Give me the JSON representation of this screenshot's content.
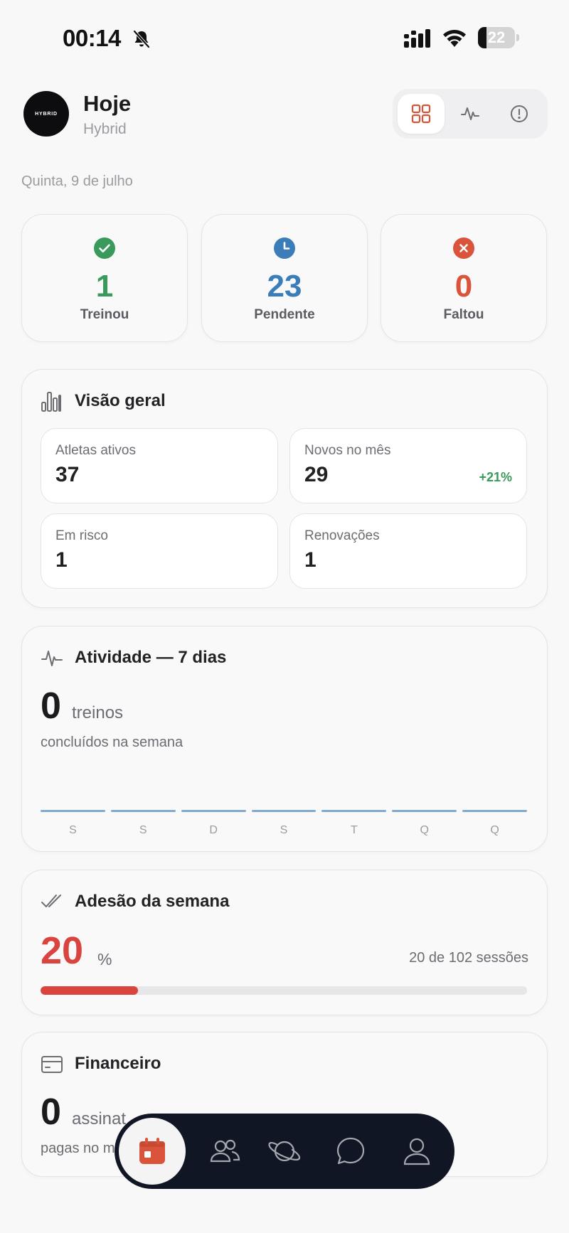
{
  "status_bar": {
    "time": "00:14",
    "battery": "22"
  },
  "header": {
    "logo_text": "HYBRID",
    "title": "Hoje",
    "subtitle": "Hybrid"
  },
  "date": "Quinta, 9 de julho",
  "stats": [
    {
      "value": "1",
      "label": "Treinou",
      "color": "#3a9a5c"
    },
    {
      "value": "23",
      "label": "Pendente",
      "color": "#3b7db8"
    },
    {
      "value": "0",
      "label": "Faltou",
      "color": "#d9543a"
    }
  ],
  "overview": {
    "title": "Visão geral",
    "items": [
      {
        "label": "Atletas ativos",
        "value": "37"
      },
      {
        "label": "Novos no mês",
        "value": "29",
        "delta": "+21%"
      },
      {
        "label": "Em risco",
        "value": "1"
      },
      {
        "label": "Renovações",
        "value": "1"
      }
    ]
  },
  "activity": {
    "title": "Atividade — 7 dias",
    "count": "0",
    "unit": "treinos",
    "subtitle": "concluídos na semana",
    "days": [
      "S",
      "S",
      "D",
      "S",
      "T",
      "Q",
      "Q"
    ],
    "values": [
      0,
      0,
      0,
      0,
      0,
      0,
      0
    ]
  },
  "adherence": {
    "title": "Adesão da semana",
    "percent": "20",
    "unit": "%",
    "sessions": "20 de 102 sessões",
    "progress": 0.2
  },
  "finance": {
    "title": "Financeiro",
    "count": "0",
    "unit": "assinat",
    "subtitle": "pagas no m"
  },
  "nav": {
    "items": [
      "calendar-icon",
      "users-icon",
      "planet-icon",
      "chat-icon",
      "profile-icon"
    ],
    "active_color": "#d9543a"
  }
}
